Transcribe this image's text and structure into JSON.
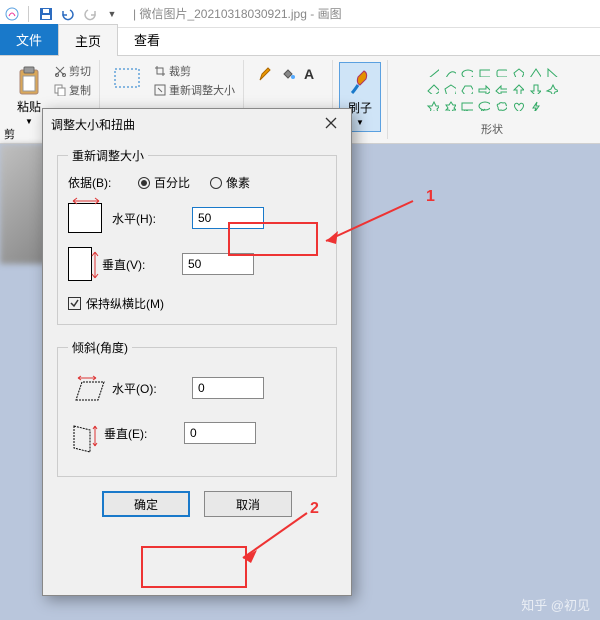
{
  "titlebar": {
    "document": "| 微信图片_20210318030921.jpg - 画图"
  },
  "tabs": {
    "file": "文件",
    "home": "主页",
    "view": "查看"
  },
  "ribbon": {
    "paste": "粘贴",
    "cut": "剪切",
    "copy": "复制",
    "crop": "裁剪",
    "resize": "重新调整大小",
    "brush": "刷子",
    "shapes_label": "形状",
    "selection_label": "剪"
  },
  "dialog": {
    "title": "调整大小和扭曲",
    "resize_legend": "重新调整大小",
    "by_label": "依据(B):",
    "percent": "百分比",
    "pixels": "像素",
    "horizontal_h": "水平(H):",
    "vertical_v": "垂直(V):",
    "h_value": "50",
    "v_value": "50",
    "aspect": "保持纵横比(M)",
    "skew_legend": "倾斜(角度)",
    "horizontal_o": "水平(O):",
    "vertical_e": "垂直(E):",
    "skew_h": "0",
    "skew_v": "0",
    "ok": "确定",
    "cancel": "取消"
  },
  "annotations": {
    "one": "1",
    "two": "2"
  },
  "watermark": "知乎 @初见"
}
